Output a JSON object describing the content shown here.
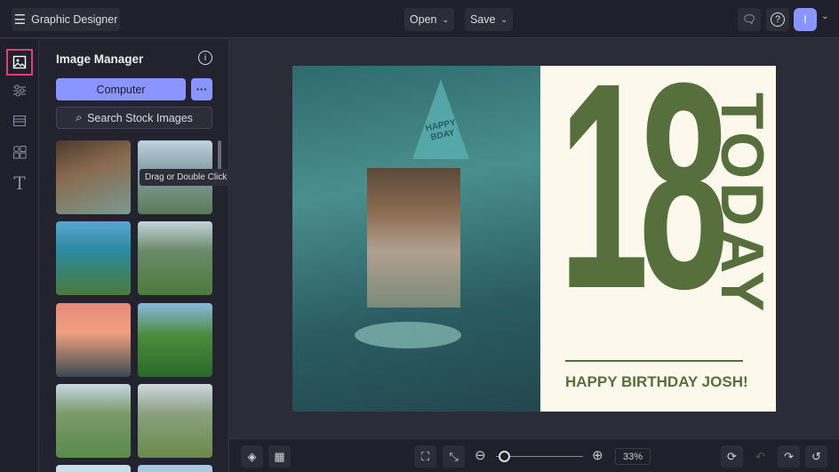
{
  "header": {
    "menu_icon": "hamburger-icon",
    "app_title": "Graphic Designer",
    "open_label": "Open",
    "save_label": "Save",
    "avatar_initial": "I"
  },
  "rail": {
    "items": [
      "image-icon",
      "sliders-icon",
      "layout-icon",
      "elements-icon",
      "text-icon"
    ]
  },
  "panel": {
    "title": "Image Manager",
    "computer_label": "Computer",
    "more_label": "···",
    "search_label": "Search Stock Images",
    "tooltip": "Drag or Double Click"
  },
  "poster": {
    "number": "18",
    "word": "TODAY",
    "message": "HAPPY BIRTHDAY JOSH!",
    "hat_text": "HAPPY BDAY",
    "colors": {
      "green": "#566f3c",
      "cream": "#fcf9ec",
      "teal": "#3f8a8c"
    }
  },
  "bottombar": {
    "zoom": "33%",
    "zoom_fraction": 0.05
  },
  "colors": {
    "accent": "#8b95ff",
    "highlight": "#e0407a"
  }
}
